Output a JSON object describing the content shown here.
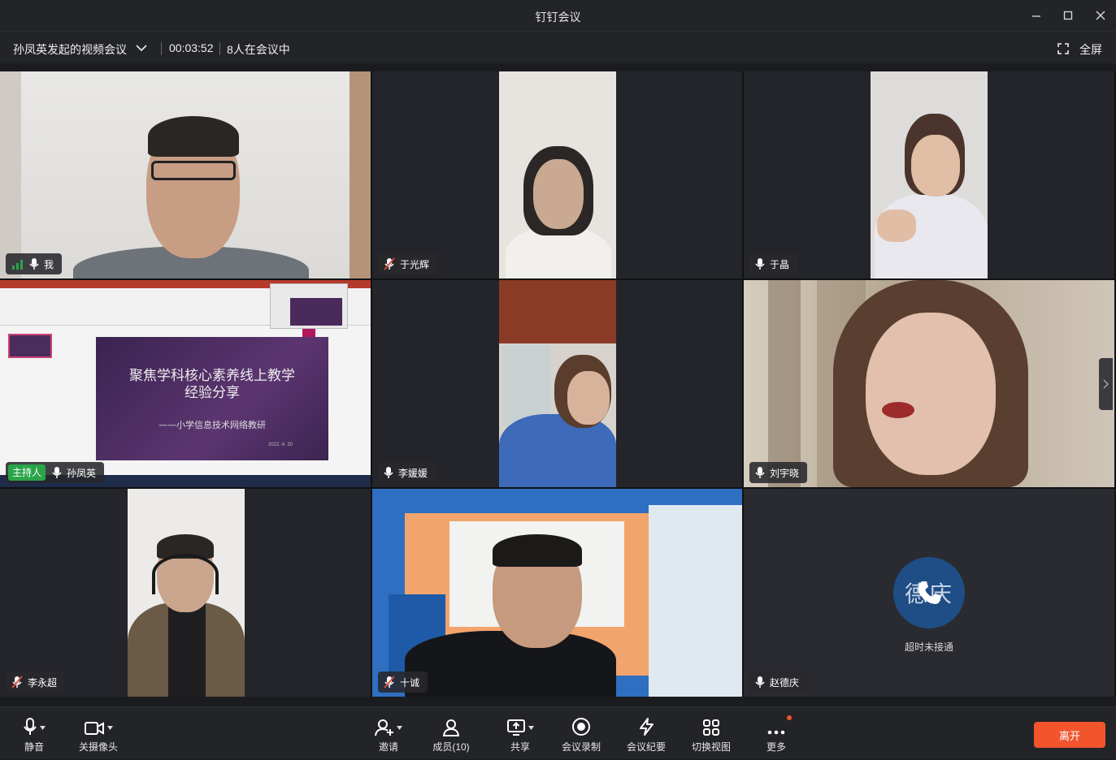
{
  "window": {
    "title": "钉钉会议"
  },
  "info": {
    "meeting_title": "孙凤英发起的视频会议",
    "elapsed": "00:03:52",
    "participants_count": "8人在会议中",
    "fullscreen_label": "全屏"
  },
  "tiles": [
    {
      "name": "我",
      "muted": false,
      "signal": true
    },
    {
      "name": "于光辉",
      "muted": true
    },
    {
      "name": "于晶",
      "muted": false
    },
    {
      "name": "孙凤英",
      "muted": false,
      "host_label": "主持人"
    },
    {
      "name": "李媛媛",
      "muted": false
    },
    {
      "name": "刘宇晓",
      "muted": false
    },
    {
      "name": "李永超",
      "muted": true
    },
    {
      "name": "十诚",
      "muted": true
    },
    {
      "name": "赵德庆",
      "muted": false,
      "avatar_text": "德庆",
      "status": "超时未接通"
    }
  ],
  "slide": {
    "title_line1": "聚焦学科核心素养线上教学",
    "title_line2": "经验分享",
    "subtitle": "——小学信息技术网络教研",
    "date": "2022. 4. 20"
  },
  "toolbar": {
    "mute": "静音",
    "camera_off": "关摄像头",
    "invite": "邀请",
    "members": "成员(10)",
    "share": "共享",
    "record": "会议录制",
    "minutes": "会议纪要",
    "switch_view": "切换视图",
    "more": "更多",
    "leave": "离开"
  },
  "colors": {
    "accent_leave": "#f2542d",
    "host_green": "#2aa44a",
    "signal_green": "#2aa44a",
    "mute_red": "#e04a3a"
  }
}
